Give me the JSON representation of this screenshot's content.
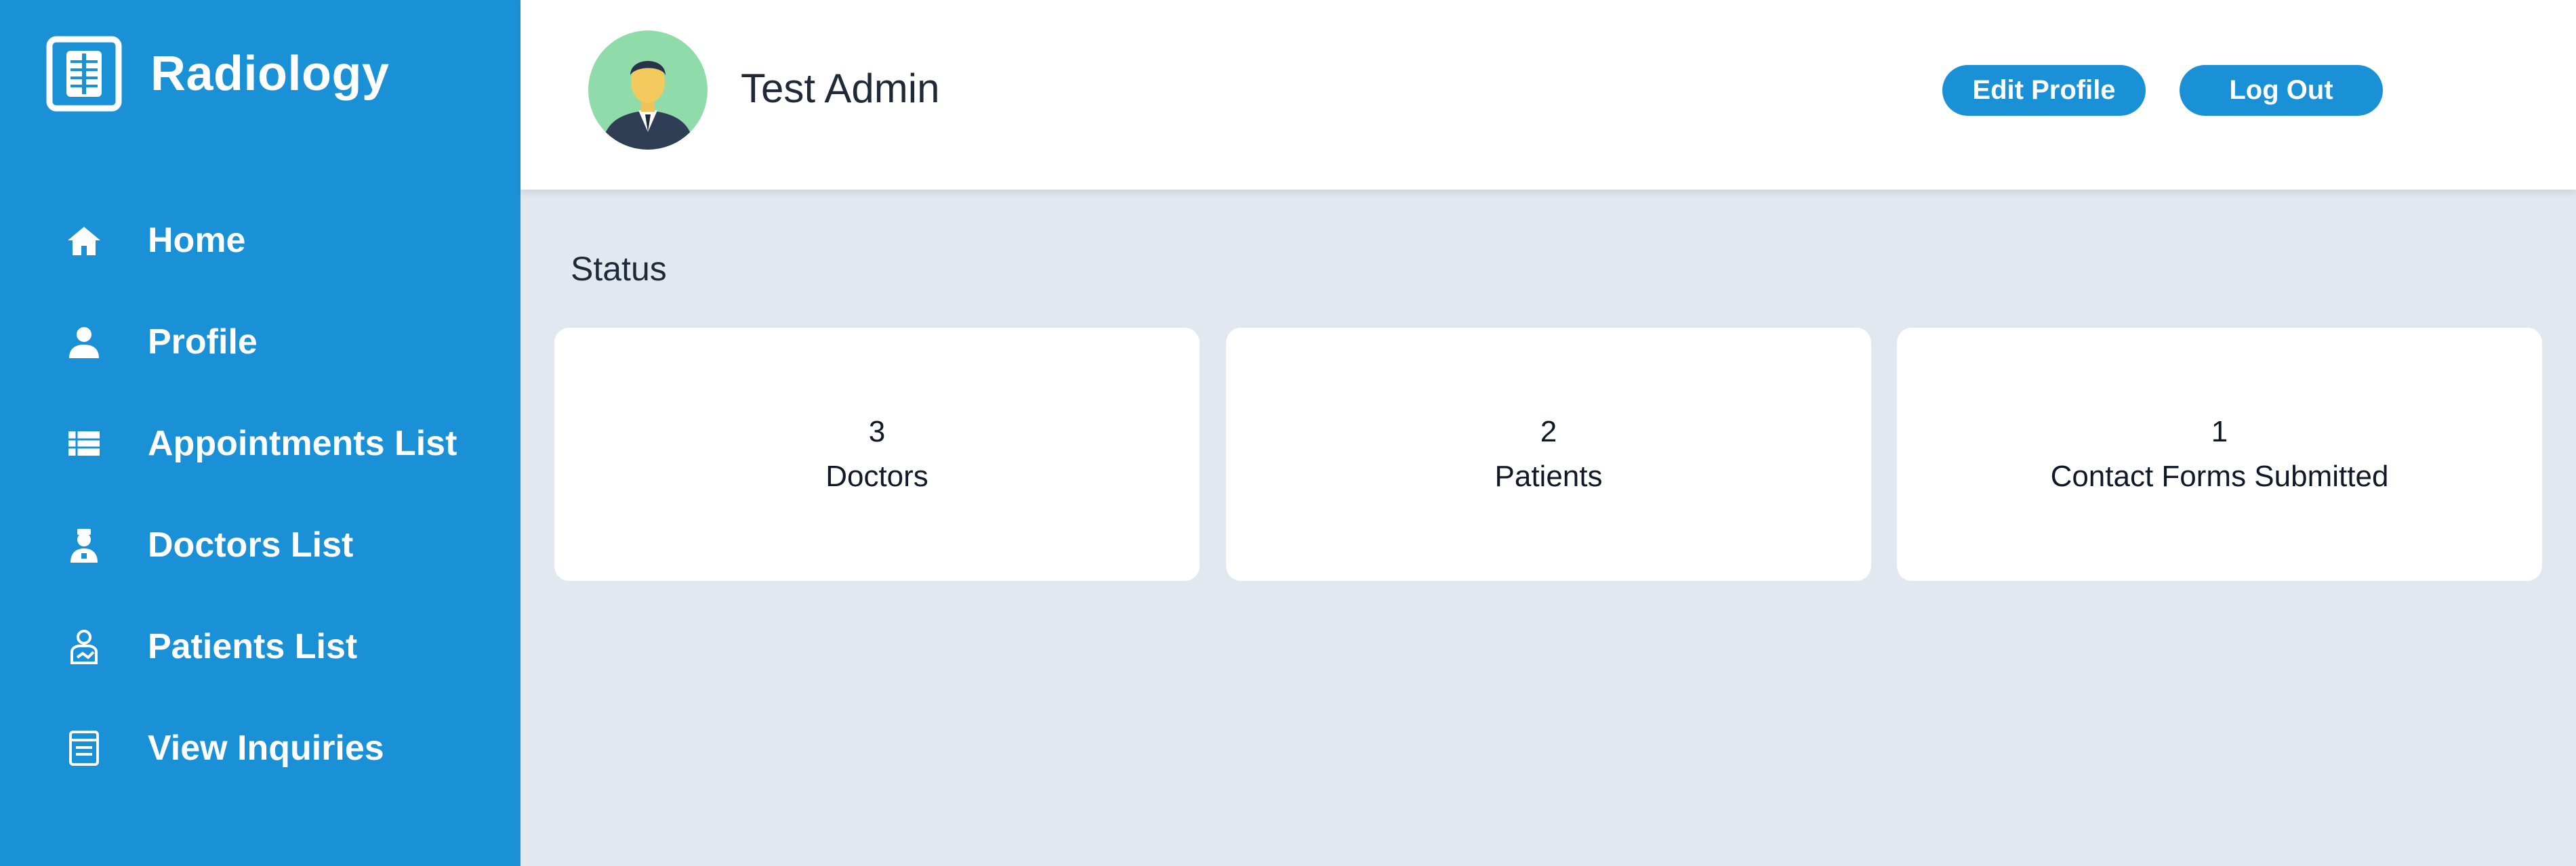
{
  "app": {
    "title": "Radiology"
  },
  "sidebar": {
    "items": [
      {
        "label": "Home",
        "icon": "home-icon"
      },
      {
        "label": "Profile",
        "icon": "user-icon"
      },
      {
        "label": "Appointments List",
        "icon": "list-icon"
      },
      {
        "label": "Doctors List",
        "icon": "doctor-icon"
      },
      {
        "label": "Patients List",
        "icon": "patient-icon"
      },
      {
        "label": "View Inquiries",
        "icon": "inquiry-icon"
      }
    ]
  },
  "header": {
    "user_name": "Test Admin",
    "edit_label": "Edit Profile",
    "logout_label": "Log Out"
  },
  "main": {
    "title": "Status",
    "cards": [
      {
        "value": "3",
        "label": "Doctors"
      },
      {
        "value": "2",
        "label": "Patients"
      },
      {
        "value": "1",
        "label": "Contact Forms Submitted"
      }
    ]
  },
  "colors": {
    "primary": "#1a91d6",
    "background": "#e2e8f0",
    "card": "#ffffff",
    "avatar_bg": "#8fdcaa"
  }
}
